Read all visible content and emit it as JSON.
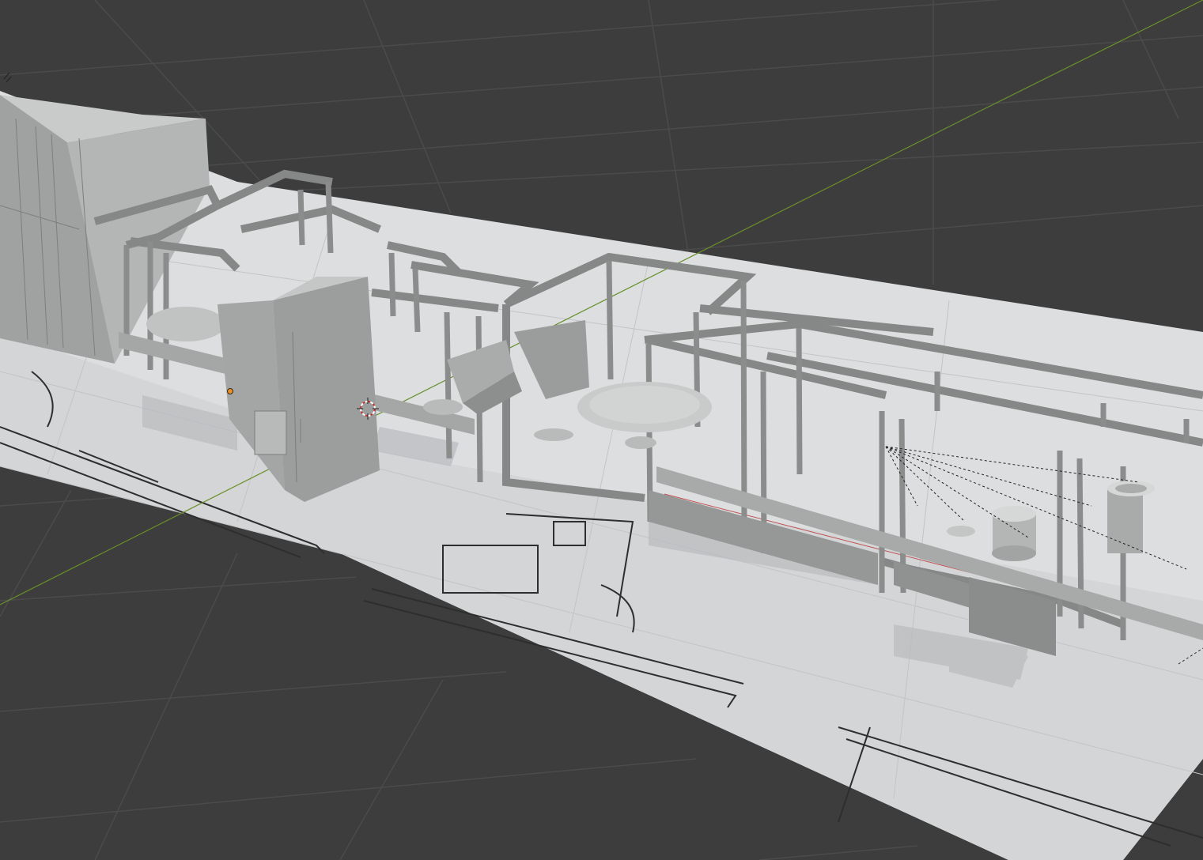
{
  "app": {
    "name": "3D Viewport",
    "mode": "solid-shading"
  },
  "viewport": {
    "background_color": "#3d3d3d",
    "grid_color": "#4a4a4a",
    "axis_y_color": "#6a8f2a",
    "floor_color": "#dcdee0",
    "model_color": "#8e918f",
    "model_light": "#b5b8b6",
    "model_dark": "#6f7270"
  },
  "objects": {
    "floor_plane": "floor-plan-texture-plane",
    "cabinet_large": "electrical-cabinet-block",
    "cabinet_small": "control-cabinet",
    "frames": "machine-frames",
    "conveyor": "conveyor-line",
    "hopper": "hopper",
    "rotary_table": "rotary-table",
    "bowl_feeder": "bowl-feeder",
    "light": "light-object",
    "cursor": "3d-cursor"
  }
}
